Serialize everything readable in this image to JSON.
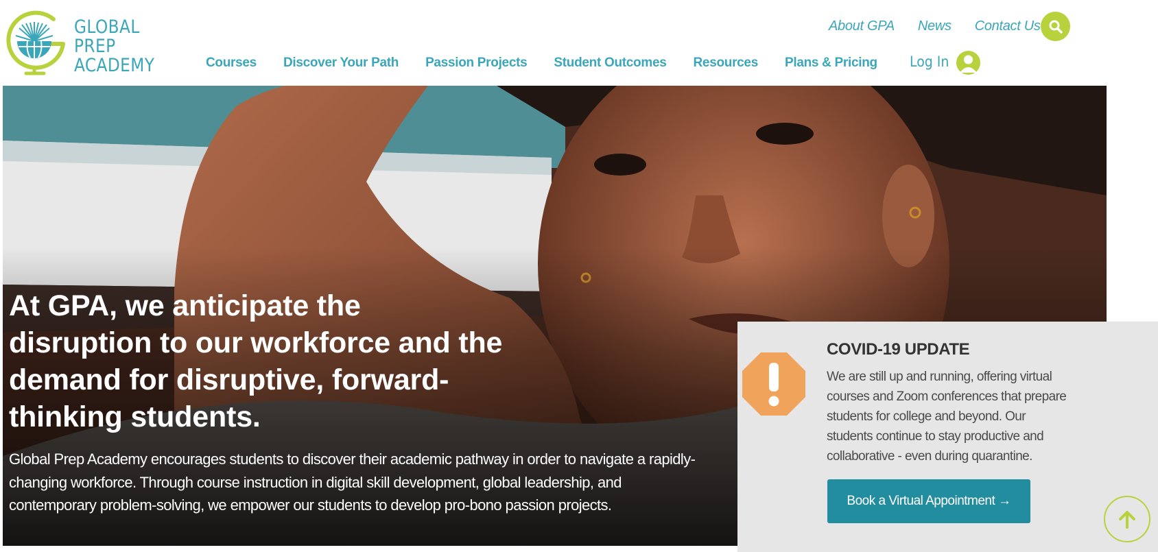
{
  "brand": {
    "name_lines": [
      "GLOBAL",
      "PREP",
      "ACADEMY"
    ],
    "logo_icon": "globe-sun-icon",
    "accent_color": "#3aa6b9",
    "lime_color": "#b8d23d"
  },
  "top_nav": {
    "links": [
      "About GPA",
      "News",
      "Contact Us"
    ],
    "search_icon": "search-icon"
  },
  "main_nav": {
    "items": [
      "Courses",
      "Discover Your Path",
      "Passion Projects",
      "Student Outcomes",
      "Resources",
      "Plans & Pricing"
    ],
    "login_label": "Log In",
    "user_icon": "user-icon"
  },
  "hero": {
    "headline": "At GPA, we anticipate the disruption to our workforce and the demand for disruptive, forward-thinking students.",
    "body": "Global Prep Academy encourages students to discover their academic pathway in order to navigate a rapidly-changing workforce. Through course instruction in digital skill development, global leadership, and contemporary problem-solving, we empower our students to develop pro-bono passion projects."
  },
  "covid_card": {
    "icon": "warning-octagon-icon",
    "icon_color": "#f0a35a",
    "title": "COVID-19 UPDATE",
    "text": "We are still up and running, offering virtual courses and Zoom conferences that prepare students for college and beyond. Our students continue to stay productive and collaborative - even during quarantine.",
    "button_label": "Book a Virtual Appointment →",
    "button_color": "#238da0"
  },
  "scroll_top": {
    "icon": "arrow-up-circle-icon"
  }
}
